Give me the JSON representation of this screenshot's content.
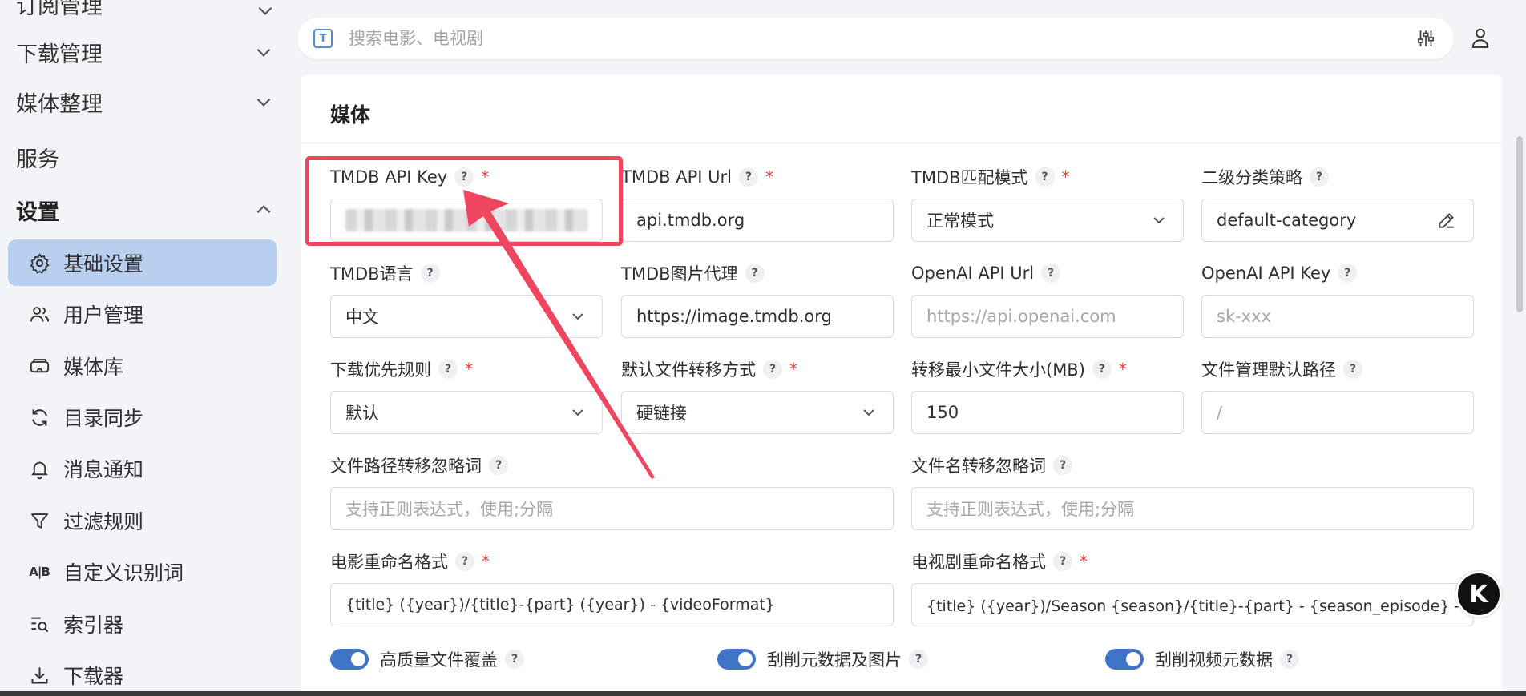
{
  "sidebar": {
    "partial_top": "订阅管理",
    "groups": [
      {
        "label": "下载管理"
      },
      {
        "label": "媒体整理"
      },
      {
        "label": "服务"
      },
      {
        "label": "设置"
      }
    ],
    "items": [
      {
        "label": "基础设置",
        "icon": "gear-icon",
        "active": true
      },
      {
        "label": "用户管理",
        "icon": "users-icon"
      },
      {
        "label": "媒体库",
        "icon": "vr-headset-icon"
      },
      {
        "label": "目录同步",
        "icon": "sync-icon"
      },
      {
        "label": "消息通知",
        "icon": "bell-icon"
      },
      {
        "label": "过滤规则",
        "icon": "filter-icon"
      },
      {
        "label": "自定义识别词",
        "icon": "ab-text-icon",
        "icon_text": "A|B"
      },
      {
        "label": "索引器",
        "icon": "search-list-icon"
      },
      {
        "label": "下载器",
        "icon": "download-icon"
      }
    ]
  },
  "search": {
    "placeholder": "搜索电影、电视剧",
    "icon_letter": "T"
  },
  "card": {
    "title": "媒体",
    "fields": [
      {
        "label": "TMDB API Key",
        "value": "",
        "required": true,
        "redacted": true
      },
      {
        "label": "TMDB API Url",
        "value": "api.tmdb.org",
        "required": true
      },
      {
        "label": "TMDB匹配模式",
        "value": "正常模式",
        "required": true,
        "type": "select"
      },
      {
        "label": "二级分类策略",
        "value": "default-category",
        "type": "edit"
      },
      {
        "label": "TMDB语言",
        "value": "中文",
        "type": "select"
      },
      {
        "label": "TMDB图片代理",
        "value": "https://image.tmdb.org"
      },
      {
        "label": "OpenAI API Url",
        "placeholder": "https://api.openai.com"
      },
      {
        "label": "OpenAI API Key",
        "placeholder": "sk-xxx"
      },
      {
        "label": "下载优先规则",
        "value": "默认",
        "required": true,
        "type": "select"
      },
      {
        "label": "默认文件转移方式",
        "value": "硬链接",
        "required": true,
        "type": "select"
      },
      {
        "label": "转移最小文件大小(MB)",
        "value": "150",
        "required": true
      },
      {
        "label": "文件管理默认路径",
        "placeholder": "/"
      },
      {
        "label": "文件路径转移忽略词",
        "placeholder": "支持正则表达式，使用;分隔"
      },
      {
        "label": "文件名转移忽略词",
        "placeholder": "支持正则表达式，使用;分隔"
      },
      {
        "label": "电影重命名格式",
        "value": "{title} ({year})/{title}-{part} ({year}) - {videoFormat}",
        "required": true
      },
      {
        "label": "电视剧重命名格式",
        "value": "{title} ({year})/Season {season}/{title}-{part} - {season_episode} - 第{episode}集",
        "required": true
      }
    ],
    "toggles": [
      {
        "label": "高质量文件覆盖",
        "on": true
      },
      {
        "label": "刮削元数据及图片",
        "on": true
      },
      {
        "label": "刮削视频元数据",
        "on": true
      }
    ]
  },
  "help_glyph": "?",
  "required_glyph": "*",
  "fab_label": "K",
  "accent_color": "#3f74c6",
  "annotation_color": "#f0455f"
}
